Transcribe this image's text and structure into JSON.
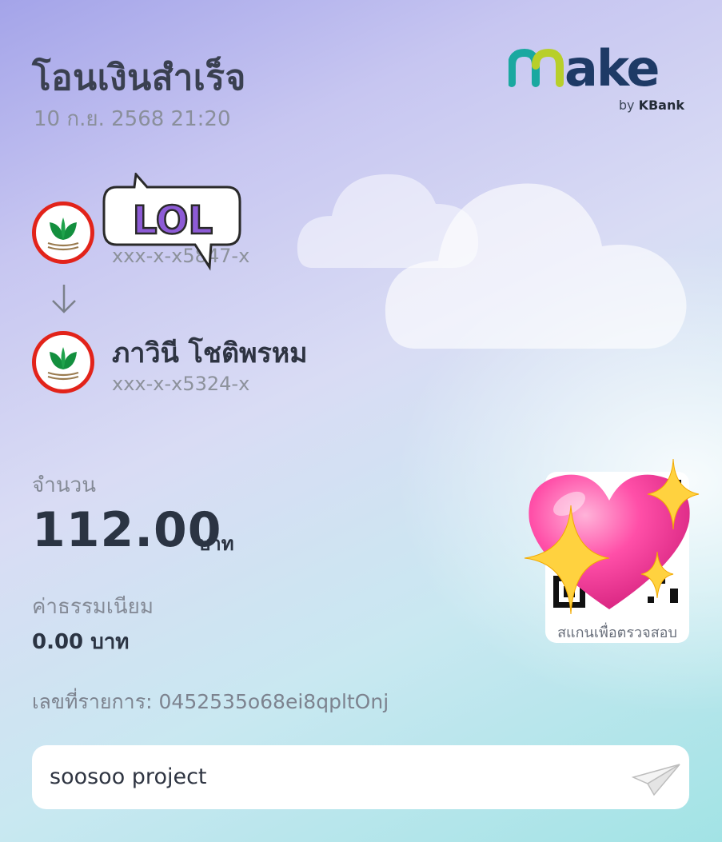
{
  "header": {
    "title": "โอนเงินสำเร็จ",
    "datetime": "10 ก.ย. 2568 21:20"
  },
  "logo": {
    "wordmark": "make",
    "byline_prefix": "by",
    "byline_brand": "KBank",
    "colors": {
      "m": "#1aa8a0",
      "a": "#b8cf2a",
      "ke": "#1e3a66"
    }
  },
  "sender": {
    "icon": "kbank-leaf-icon",
    "account_no": "xxx-x-x5847-x",
    "sticker": "LOL"
  },
  "transfer_arrow": "arrow-down-icon",
  "receiver": {
    "icon": "kbank-leaf-icon",
    "name": "ภาวินี โชติพรหม",
    "account_no": "xxx-x-x5324-x"
  },
  "amount": {
    "label": "จำนวน",
    "value": "112.00",
    "unit": "บาท"
  },
  "fee": {
    "label": "ค่าธรรมเนียม",
    "value": "0.00 บาท"
  },
  "reference": {
    "text": "เลขที่รายการ: 0452535o68ei8qpltOnj"
  },
  "qr": {
    "caption": "สแกนเพื่อตรวจสอบ"
  },
  "memo": {
    "text": "soosoo project",
    "send_icon": "paper-plane-icon"
  },
  "colors": {
    "kbank_red": "#e2231a",
    "kbank_green": "#138f3e",
    "heart_pink": "#ff4fa8",
    "sparkle_yellow": "#ffd23f"
  }
}
